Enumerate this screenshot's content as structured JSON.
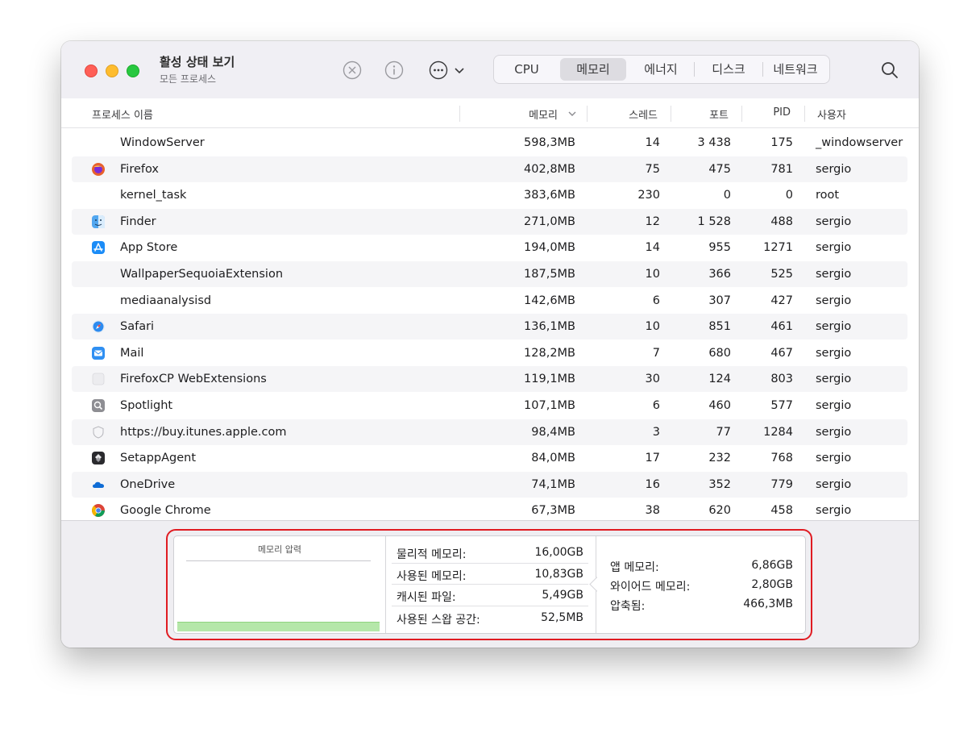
{
  "app": {
    "title": "활성 상태 보기",
    "subtitle": "모든 프로세스"
  },
  "tabs": [
    {
      "label": "CPU",
      "active": false
    },
    {
      "label": "메모리",
      "active": true
    },
    {
      "label": "에너지",
      "active": false
    },
    {
      "label": "디스크",
      "active": false
    },
    {
      "label": "네트워크",
      "active": false
    }
  ],
  "toolbar_icons": [
    "stop-process-icon",
    "info-icon",
    "more-options-icon",
    "chevron-down-icon",
    "search-icon"
  ],
  "columns": {
    "name": "프로세스 이름",
    "memory": "메모리",
    "threads": "스레드",
    "ports": "포트",
    "pid": "PID",
    "user": "사용자"
  },
  "processes": [
    {
      "name": "WindowServer",
      "icon": "none",
      "memory": "598,3MB",
      "threads": "14",
      "ports": "3 438",
      "pid": "175",
      "user": "_windowserver"
    },
    {
      "name": "Firefox",
      "icon": "firefox-icon",
      "memory": "402,8MB",
      "threads": "75",
      "ports": "475",
      "pid": "781",
      "user": "sergio"
    },
    {
      "name": "kernel_task",
      "icon": "none",
      "memory": "383,6MB",
      "threads": "230",
      "ports": "0",
      "pid": "0",
      "user": "root"
    },
    {
      "name": "Finder",
      "icon": "finder-icon",
      "memory": "271,0MB",
      "threads": "12",
      "ports": "1 528",
      "pid": "488",
      "user": "sergio"
    },
    {
      "name": "App Store",
      "icon": "app-store-icon",
      "memory": "194,0MB",
      "threads": "14",
      "ports": "955",
      "pid": "1271",
      "user": "sergio"
    },
    {
      "name": "WallpaperSequoiaExtension",
      "icon": "none",
      "memory": "187,5MB",
      "threads": "10",
      "ports": "366",
      "pid": "525",
      "user": "sergio"
    },
    {
      "name": "mediaanalysisd",
      "icon": "none",
      "memory": "142,6MB",
      "threads": "6",
      "ports": "307",
      "pid": "427",
      "user": "sergio"
    },
    {
      "name": "Safari",
      "icon": "safari-icon",
      "memory": "136,1MB",
      "threads": "10",
      "ports": "851",
      "pid": "461",
      "user": "sergio"
    },
    {
      "name": "Mail",
      "icon": "mail-icon",
      "memory": "128,2MB",
      "threads": "7",
      "ports": "680",
      "pid": "467",
      "user": "sergio"
    },
    {
      "name": "FirefoxCP WebExtensions",
      "icon": "generic-process-icon",
      "memory": "119,1MB",
      "threads": "30",
      "ports": "124",
      "pid": "803",
      "user": "sergio"
    },
    {
      "name": "Spotlight",
      "icon": "spotlight-icon",
      "memory": "107,1MB",
      "threads": "6",
      "ports": "460",
      "pid": "577",
      "user": "sergio"
    },
    {
      "name": "https://buy.itunes.apple.com",
      "icon": "shield-icon",
      "memory": "98,4MB",
      "threads": "3",
      "ports": "77",
      "pid": "1284",
      "user": "sergio"
    },
    {
      "name": "SetappAgent",
      "icon": "setapp-icon",
      "memory": "84,0MB",
      "threads": "17",
      "ports": "232",
      "pid": "768",
      "user": "sergio"
    },
    {
      "name": "OneDrive",
      "icon": "onedrive-icon",
      "memory": "74,1MB",
      "threads": "16",
      "ports": "352",
      "pid": "779",
      "user": "sergio"
    },
    {
      "name": "Google Chrome",
      "icon": "chrome-icon",
      "memory": "67,3MB",
      "threads": "38",
      "ports": "620",
      "pid": "458",
      "user": "sergio"
    }
  ],
  "memory_pressure": {
    "label": "메모리 압력",
    "level": 0.13,
    "color": "#b5e7a9"
  },
  "memory_stats": [
    {
      "label": "물리적 메모리:",
      "value": "16,00GB"
    },
    {
      "label": "사용된 메모리:",
      "value": "10,83GB"
    },
    {
      "label": "캐시된 파일:",
      "value": "5,49GB"
    },
    {
      "label": "사용된 스왑 공간:",
      "value": "52,5MB"
    }
  ],
  "memory_breakdown": [
    {
      "label": "앱 메모리:",
      "value": "6,86GB"
    },
    {
      "label": "와이어드 메모리:",
      "value": "2,80GB"
    },
    {
      "label": "압축됨:",
      "value": "466,3MB"
    }
  ],
  "colors": {
    "highlight": "#e01b22",
    "active_tab": "#dddce1",
    "row_alt": "#f5f5f7"
  }
}
